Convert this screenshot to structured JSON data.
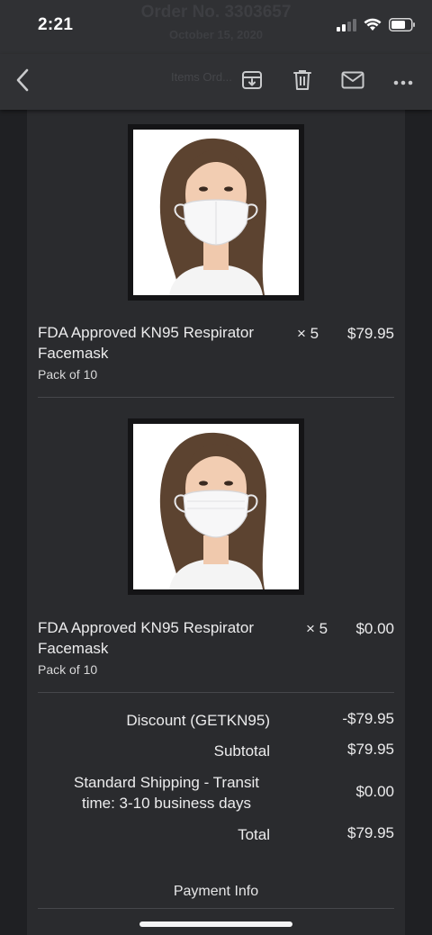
{
  "status_bar": {
    "time": "2:21",
    "icons": [
      "cellular-signal-icon",
      "wifi-icon",
      "battery-icon"
    ]
  },
  "header": {
    "ghost_title": "Order No. 3303657",
    "ghost_date": "October 15, 2020",
    "ghost_subtitle": "Items Ord..."
  },
  "toolbar": {
    "icons": [
      "back-chevron-icon",
      "archive-icon",
      "trash-icon",
      "mail-icon",
      "more-icon"
    ]
  },
  "items": [
    {
      "name": "FDA Approved KN95 Respirator Facemask",
      "variant": "Pack of 10",
      "quantity": "× 5",
      "price": "$79.95"
    },
    {
      "name": "FDA Approved KN95 Respirator Facemask",
      "variant": "Pack of 10",
      "quantity": "× 5",
      "price": "$0.00"
    }
  ],
  "summary": {
    "discount_label": "Discount (GETKN95)",
    "discount_value": "-$79.95",
    "subtotal_label": "Subtotal",
    "subtotal_value": "$79.95",
    "shipping_label": "Standard Shipping - Transit time: 3-10 business days",
    "shipping_value": "$0.00",
    "total_label": "Total",
    "total_value": "$79.95"
  },
  "payment_info_label": "Payment Info",
  "colors": {
    "background": "#1f2023",
    "toolbar": "#303134",
    "panel": "#2a2b2e",
    "text": "#ececed"
  }
}
